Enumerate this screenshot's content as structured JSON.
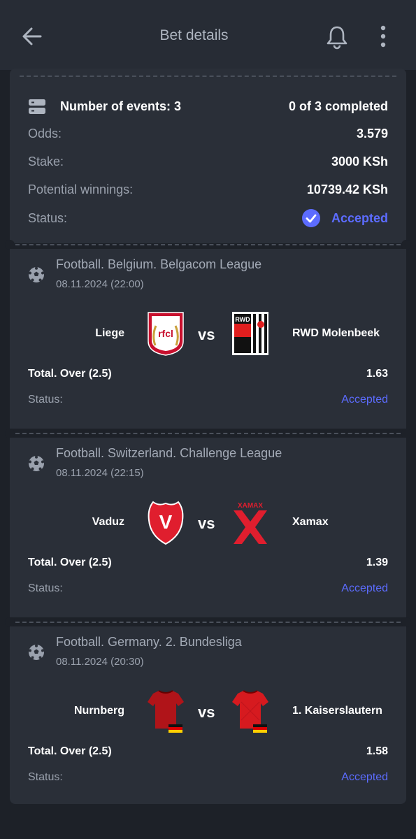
{
  "header": {
    "title": "Bet details"
  },
  "summary": {
    "events_label": "Number of events: 3",
    "completed": "0 of 3 completed",
    "odds_label": "Odds:",
    "odds_value": "3.579",
    "stake_label": "Stake:",
    "stake_value": "3000 KSh",
    "winnings_label": "Potential winnings:",
    "winnings_value": "10739.42 KSh",
    "status_label": "Status:",
    "status_value": "Accepted"
  },
  "events": [
    {
      "league": "Football. Belgium. Belgacom League",
      "datetime": "08.11.2024 (22:00)",
      "home": "Liege",
      "away": "RWD Molenbeek",
      "vs": "vs",
      "market": "Total. Over (2.5)",
      "odds": "1.63",
      "status_label": "Status:",
      "status": "Accepted",
      "home_logo_text": "rfcl",
      "away_logo_text": "RWD"
    },
    {
      "league": "Football. Switzerland. Challenge League",
      "datetime": "08.11.2024 (22:15)",
      "home": "Vaduz",
      "away": "Xamax",
      "vs": "vs",
      "market": "Total. Over (2.5)",
      "odds": "1.39",
      "status_label": "Status:",
      "status": "Accepted",
      "home_logo_text": "V",
      "away_logo_text": "XAMAX"
    },
    {
      "league": "Football. Germany. 2. Bundesliga",
      "datetime": "08.11.2024 (20:30)",
      "home": "Nurnberg",
      "away": "1. Kaiserslautern",
      "vs": "vs",
      "market": "Total. Over (2.5)",
      "odds": "1.58",
      "status_label": "Status:",
      "status": "Accepted"
    }
  ],
  "colors": {
    "accent": "#5c6cff",
    "card": "#2a2f38",
    "background": "#1d2128"
  }
}
